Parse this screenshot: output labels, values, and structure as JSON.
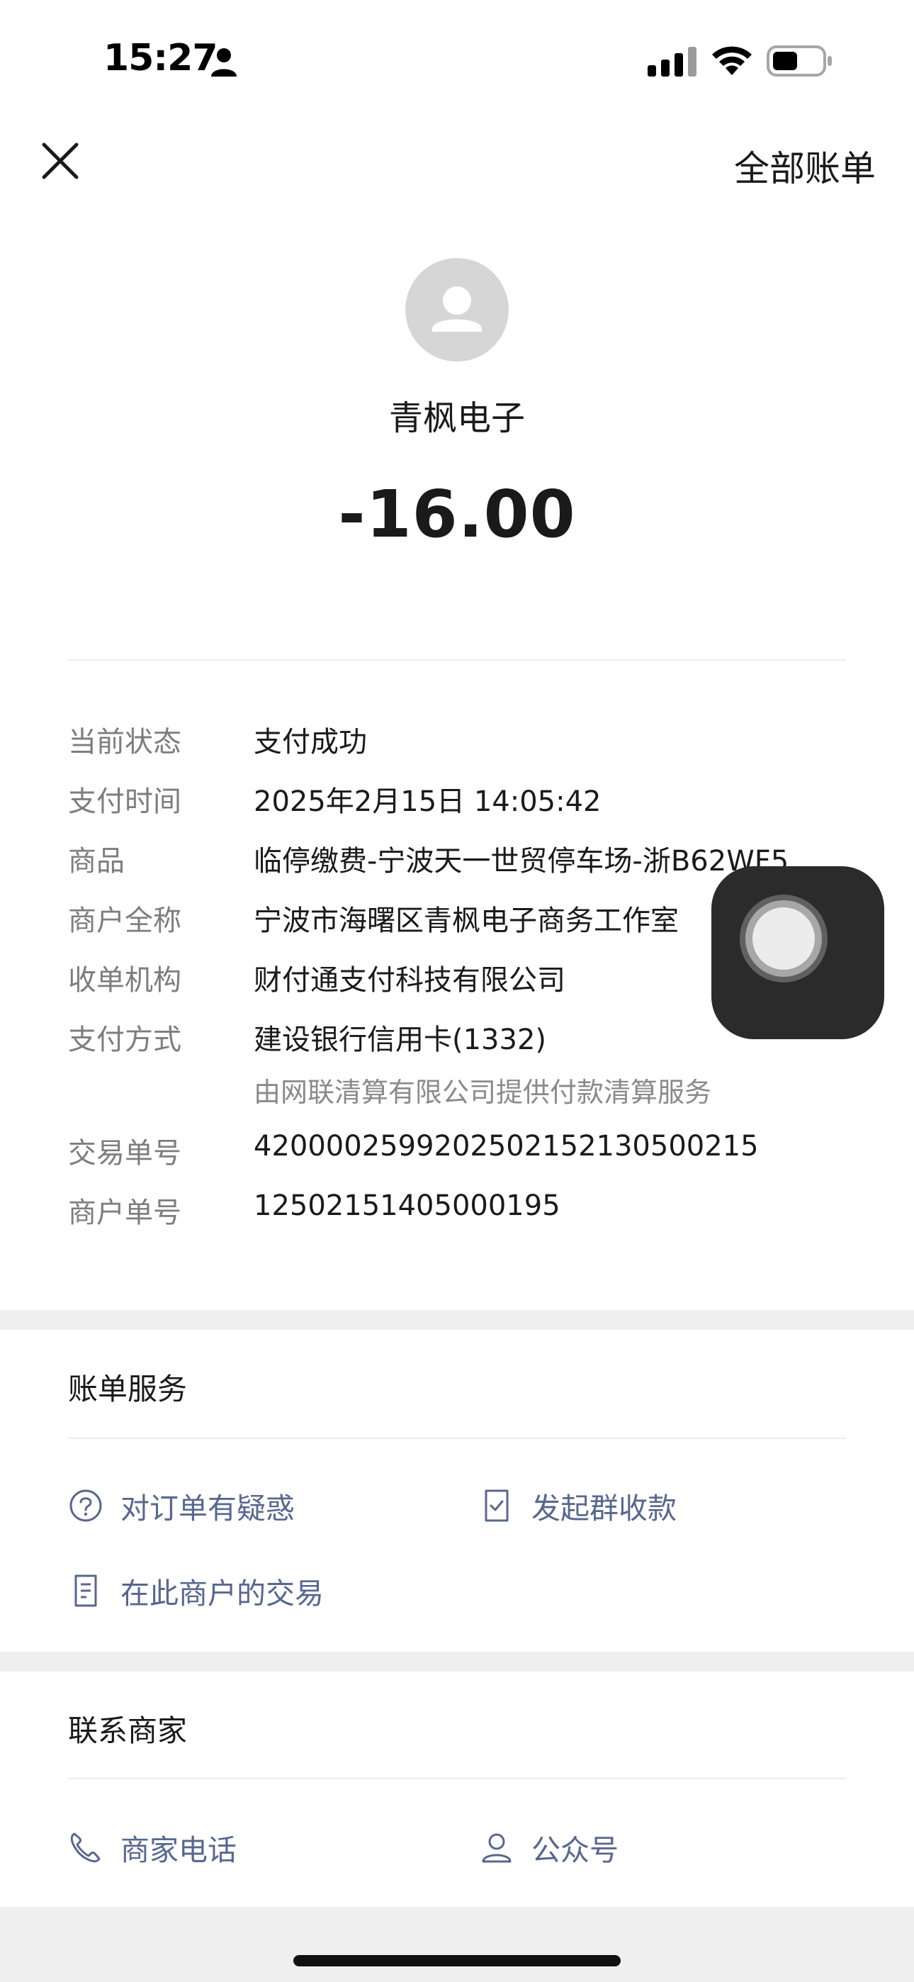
{
  "status_bar": {
    "time": "15:27"
  },
  "nav": {
    "right_label": "全部账单"
  },
  "header": {
    "merchant": "青枫电子",
    "amount": "-16.00"
  },
  "details": [
    {
      "label": "当前状态",
      "value": "支付成功"
    },
    {
      "label": "支付时间",
      "value": "2025年2月15日 14:05:42"
    },
    {
      "label": "商品",
      "value": "临停缴费-宁波天一世贸停车场-浙B62WF5"
    },
    {
      "label": "商户全称",
      "value": "宁波市海曙区青枫电子商务工作室"
    },
    {
      "label": "收单机构",
      "value": "财付通支付科技有限公司"
    },
    {
      "label": "支付方式",
      "value": "建设银行信用卡(1332)",
      "sub": "由网联清算有限公司提供付款清算服务"
    },
    {
      "label": "交易单号",
      "value": "4200002599202502152130500215"
    },
    {
      "label": "商户单号",
      "value": "12502151405000195"
    }
  ],
  "bill_service": {
    "title": "账单服务",
    "links": [
      "对订单有疑惑",
      "发起群收款",
      "在此商户的交易"
    ]
  },
  "contact": {
    "title": "联系商家",
    "links": [
      "商家电话",
      "公众号"
    ]
  },
  "colors": {
    "link": "#57678f",
    "label": "#7d7d7d",
    "band": "#efefef"
  }
}
